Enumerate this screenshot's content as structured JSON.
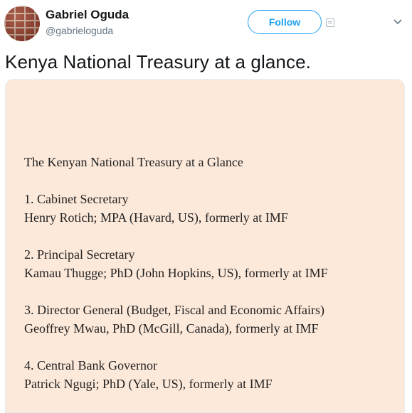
{
  "author": {
    "name": "Gabriel Oguda",
    "handle": "@gabrieloguda"
  },
  "actions": {
    "follow_label": "Follow"
  },
  "tweet": {
    "text": "Kenya National Treasury at a glance."
  },
  "image_text": {
    "title": "The Kenyan National Treasury at a Glance",
    "items": [
      {
        "role": "1. Cabinet Secretary",
        "person": "Henry Rotich; MPA (Havard, US), formerly at IMF"
      },
      {
        "role": "2. Principal Secretary",
        "person": "Kamau Thugge; PhD (John Hopkins, US), formerly at IMF"
      },
      {
        "role": "3. Director General (Budget, Fiscal and Economic Affairs)",
        "person": "Geoffrey Mwau, PhD (McGill, Canada), formerly at IMF"
      },
      {
        "role": "4. Central Bank Governor",
        "person": "Patrick Ngugi; PhD (Yale, US), formerly at IMF"
      }
    ]
  },
  "colors": {
    "accent": "#1da1f2",
    "media_background": "#fde9da",
    "secondary_text": "#657786"
  },
  "icons": {
    "card": "card-icon",
    "menu": "chevron-down-icon"
  }
}
